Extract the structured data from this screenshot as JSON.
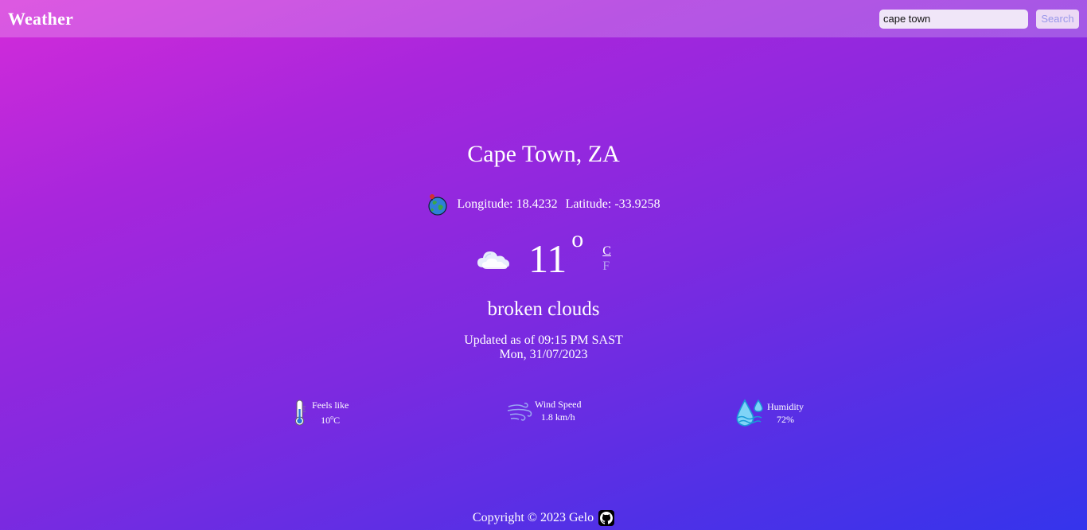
{
  "header": {
    "app_title": "Weather",
    "search": {
      "value": "cape town",
      "placeholder": ""
    },
    "search_button_label": "Search"
  },
  "location": {
    "city": "Cape Town, ZA",
    "longitude_label": "Longitude:",
    "longitude": "18.4232",
    "latitude_label": "Latitude:",
    "latitude": "-33.9258"
  },
  "current": {
    "temperature": "11",
    "degree_symbol": "o",
    "unit_c": "C",
    "unit_f": "F",
    "description": "broken clouds",
    "updated_line": "Updated as of 09:15 PM SAST",
    "date_line": "Mon, 31/07/2023",
    "condition_icon": "cloud-icon"
  },
  "stats": {
    "feels_like": {
      "label": "Feels like",
      "value": "10",
      "unit_sup": "o",
      "unit": "C",
      "icon": "thermometer-icon"
    },
    "wind": {
      "label": "Wind Speed",
      "value": "1.8 km/h",
      "icon": "wind-icon"
    },
    "humidity": {
      "label": "Humidity",
      "value": "72%",
      "icon": "water-drops-icon"
    }
  },
  "footer": {
    "copyright": "Copyright © 2023 Gelo",
    "icon": "github-icon"
  },
  "colors": {
    "gradient_start": "#d42bd9",
    "gradient_end": "#3534ec",
    "unit_inactive": "#b9a6f0"
  }
}
